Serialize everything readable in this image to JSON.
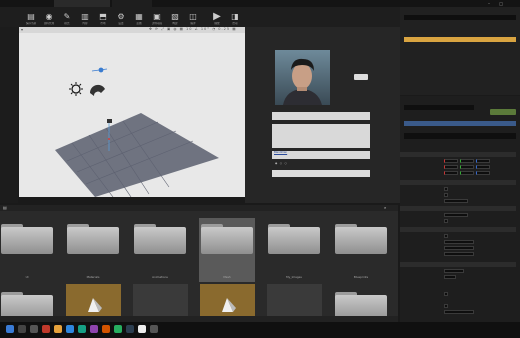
{
  "title_tabs": [
    "",
    "",
    ""
  ],
  "toolbar": [
    {
      "label": "保存当前",
      "icon": "save-icon"
    },
    {
      "label": "源码管理",
      "icon": "source-control-icon"
    },
    {
      "label": "模式",
      "icon": "modes-icon"
    },
    {
      "label": "内容",
      "icon": "content-icon"
    },
    {
      "label": "市场",
      "icon": "marketplace-icon"
    },
    {
      "label": "设置",
      "icon": "settings-icon"
    },
    {
      "label": "蓝图",
      "icon": "blueprints-icon"
    },
    {
      "label": "过场动画",
      "icon": "cinematics-icon"
    },
    {
      "label": "构建",
      "icon": "build-icon"
    },
    {
      "label": "编译",
      "icon": "compile-icon"
    },
    {
      "label": "播放",
      "icon": "play-icon"
    },
    {
      "label": "启动",
      "icon": "launch-icon"
    }
  ],
  "preview": {
    "header": "",
    "button_right": "",
    "field1": "",
    "field2": "",
    "name_value": "Blendman",
    "bottom_button": "",
    "radio": [
      "",
      "",
      ""
    ]
  },
  "outliner": {
    "search_placeholder": "",
    "rows": [
      "",
      "",
      "",
      "",
      "",
      "",
      "",
      "",
      "",
      "",
      ""
    ]
  },
  "details": {
    "search_placeholder": "",
    "component_selected": "",
    "sections": [
      "",
      "",
      "",
      "",
      ""
    ],
    "props": [
      "",
      "",
      "",
      "",
      "",
      "",
      "",
      "",
      "",
      "",
      "",
      "",
      "",
      "",
      "",
      "",
      "",
      "",
      "",
      "",
      "",
      "",
      "",
      ""
    ]
  },
  "content": {
    "folders": [
      "",
      "",
      "",
      "",
      "",
      ""
    ],
    "folder_labels": [
      "UI",
      "Materials",
      "Animations",
      "Mesh",
      "My_Images",
      "Blueprints"
    ],
    "assets": [
      "",
      "",
      "",
      "",
      "",
      "",
      "",
      "",
      "",
      ""
    ],
    "asset_labels": [
      "",
      "",
      "",
      "",
      "",
      "",
      "",
      "",
      "",
      ""
    ],
    "status": ""
  },
  "colors": {
    "accent": "#d9a441",
    "selection": "#3a5a8a",
    "bg": "#1a1a1a"
  }
}
